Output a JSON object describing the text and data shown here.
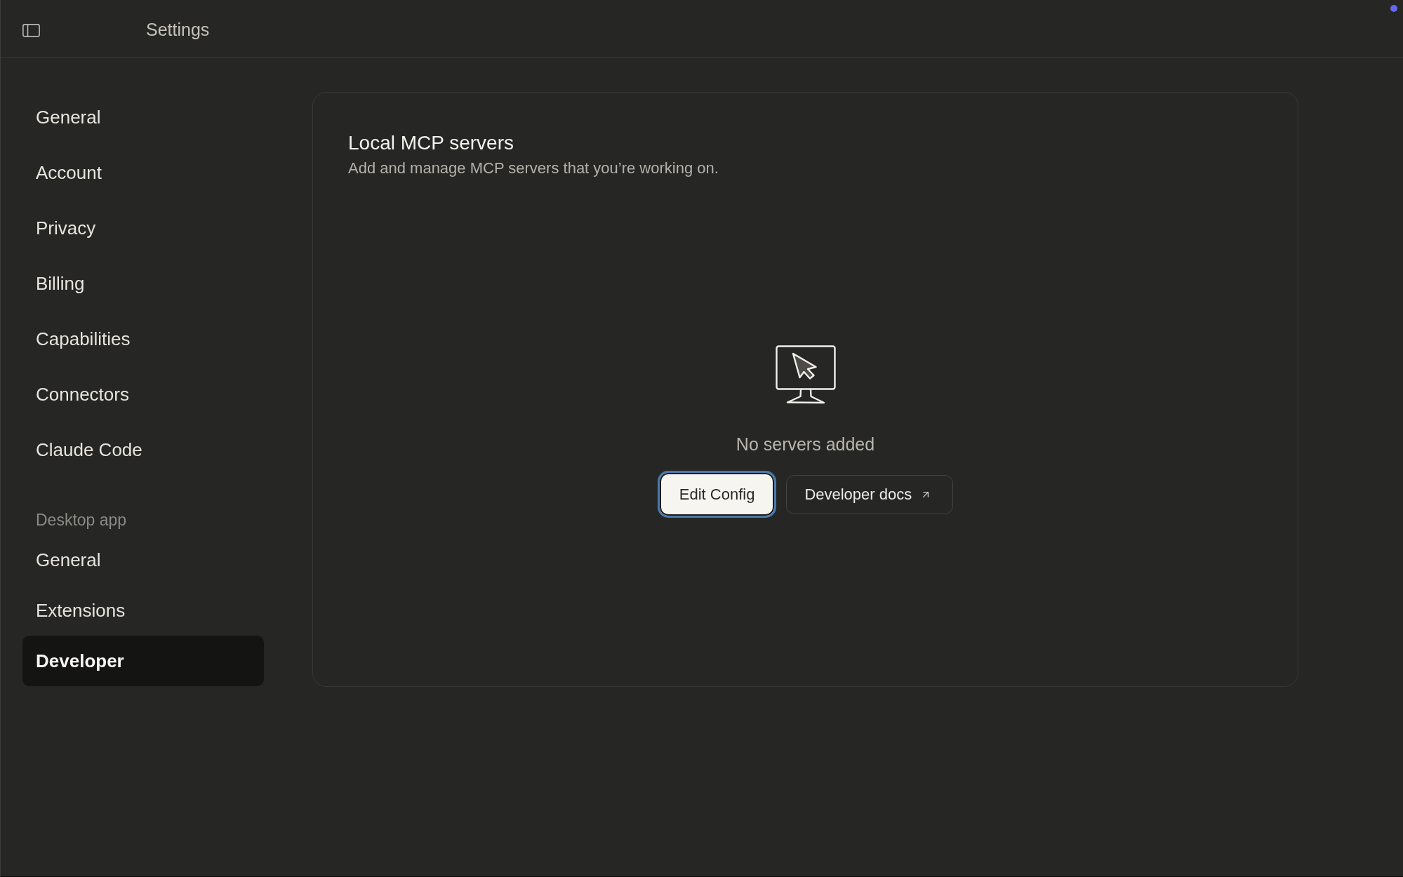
{
  "window": {
    "title": "Settings"
  },
  "sidebar": {
    "sections": [
      {
        "items": [
          {
            "label": "General",
            "selected": false
          },
          {
            "label": "Account",
            "selected": false
          },
          {
            "label": "Privacy",
            "selected": false
          },
          {
            "label": "Billing",
            "selected": false
          },
          {
            "label": "Capabilities",
            "selected": false
          },
          {
            "label": "Connectors",
            "selected": false
          },
          {
            "label": "Claude Code",
            "selected": false
          }
        ]
      },
      {
        "heading": "Desktop app",
        "items": [
          {
            "label": "General",
            "selected": false
          },
          {
            "label": "Extensions",
            "selected": false
          },
          {
            "label": "Developer",
            "selected": true
          }
        ]
      }
    ]
  },
  "panel": {
    "title": "Local MCP servers",
    "description": "Add and manage MCP servers that you’re working on.",
    "empty_state": {
      "message": "No servers added"
    },
    "buttons": [
      {
        "label": "Edit Config",
        "kind": "primary",
        "focused": true
      },
      {
        "label": "Developer docs",
        "kind": "link",
        "focused": false
      }
    ]
  }
}
